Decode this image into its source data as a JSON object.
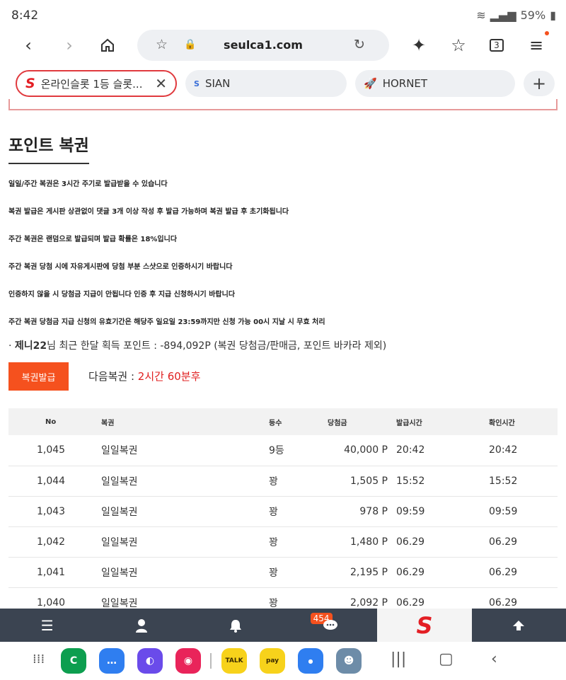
{
  "status": {
    "time": "8:42",
    "battery": "59%"
  },
  "browser": {
    "url": "seulca1.com",
    "tabs": [
      {
        "icon": "S",
        "label": "온라인슬롯 1등 슬롯..."
      },
      {
        "icon": "S",
        "label": "SIAN"
      },
      {
        "icon": "🚀",
        "label": "HORNET"
      }
    ]
  },
  "page": {
    "title": "포인트 복권",
    "notices": [
      "일일/주간 복권은 3시간 주기로 발급받을 수 있습니다",
      "복권 발급은 게시판 상관없이 댓글 3개 이상 작성 후 발급 가능하며 복권 발급 후 초기화됩니다",
      "주간 복권은 랜덤으로 발급되며 발급 확률은 18%입니다",
      "주간 복권 당첨 시에 자유게시판에 당첨 부분 스샷으로 인증하시기 바랍니다",
      "인증하지 않을 시 당첨금 지급이 안됩니다 인증 후 지급 신청하시기 바랍니다",
      "주간 복권 당첨금 지급 신청의 유효기간은 해당주 일요일 23:59까지만 신청 가능 00시 지날 시 무효 처리"
    ],
    "points": {
      "bullet": "·",
      "user": "제니22",
      "text": "님 최근 한달 획득 포인트 : -894,092P (복권 당첨금/판매금, 포인트 바카라 제외)"
    },
    "issue_button": "복권발급",
    "next_label": "다음복권 : ",
    "next_value": "2시간 60분후",
    "table": {
      "headers": [
        "No",
        "복권",
        "등수",
        "당첨금",
        "발급시간",
        "확인시간"
      ],
      "rows": [
        [
          "1,045",
          "일일복권",
          "9등",
          "40,000 P",
          "20:42",
          "20:42"
        ],
        [
          "1,044",
          "일일복권",
          "꽝",
          "1,505 P",
          "15:52",
          "15:52"
        ],
        [
          "1,043",
          "일일복권",
          "꽝",
          "978 P",
          "09:59",
          "09:59"
        ],
        [
          "1,042",
          "일일복권",
          "꽝",
          "1,480 P",
          "06.29",
          "06.29"
        ],
        [
          "1,041",
          "일일복권",
          "꽝",
          "2,195 P",
          "06.29",
          "06.29"
        ],
        [
          "1,040",
          "일일복권",
          "꽝",
          "2,092 P",
          "06.29",
          "06.29"
        ]
      ]
    }
  },
  "site_nav": {
    "badge": "454",
    "logo": "S"
  },
  "colors": {
    "accent": "#f5511e",
    "nav_bg": "#3b4451",
    "tab_border": "#e03a3e",
    "next_red": "#e02020"
  },
  "icons": [
    "back-icon",
    "forward-icon",
    "home-icon",
    "star-icon",
    "lock-icon",
    "reload-icon",
    "sparkle-icon",
    "bookmark-icon",
    "tabs-icon",
    "menu-icon",
    "close-icon",
    "plus-icon",
    "hamburger-icon",
    "user-icon",
    "bell-icon",
    "chat-icon",
    "arrow-up-icon"
  ],
  "tabs_count": "3"
}
